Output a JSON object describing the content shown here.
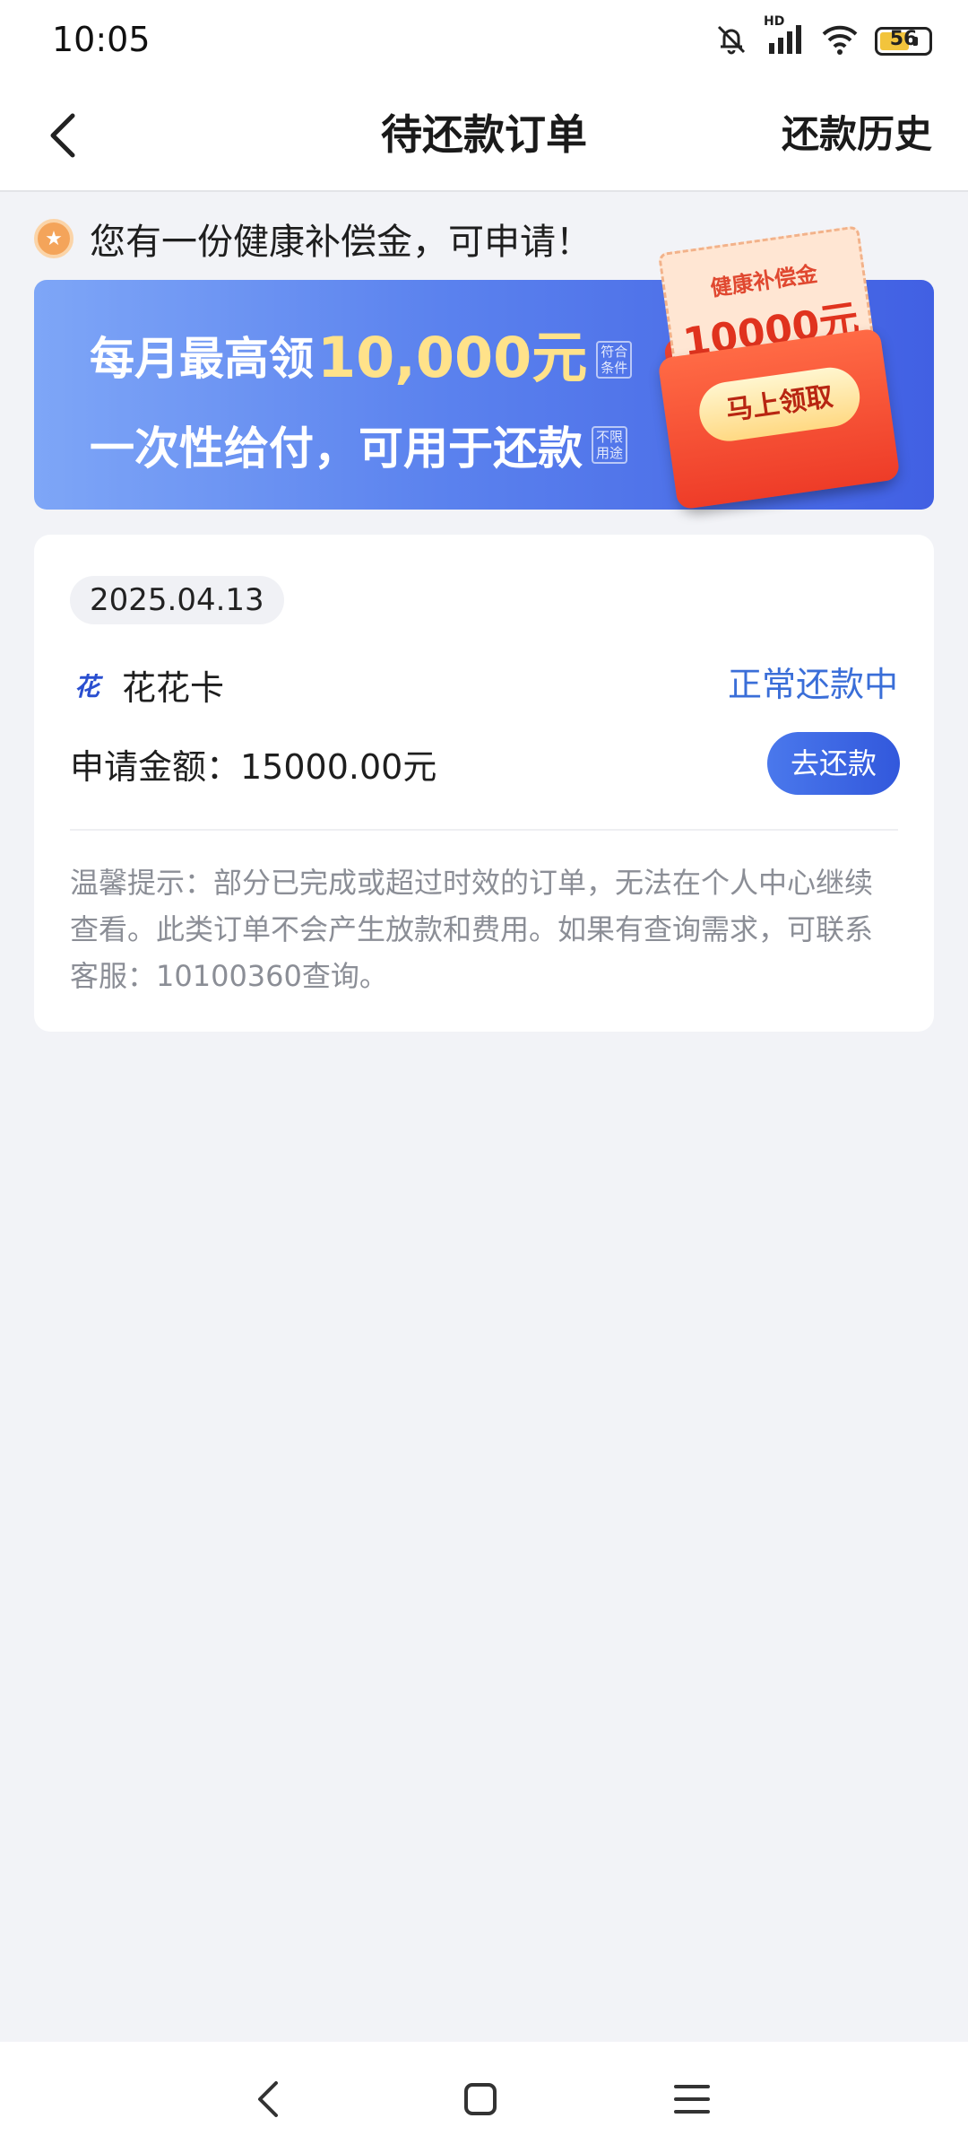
{
  "status_bar": {
    "time": "10:05",
    "network": "HD",
    "battery": "56",
    "icons": [
      "mute-icon",
      "signal-icon",
      "wifi-icon",
      "battery-icon"
    ]
  },
  "navbar": {
    "title": "待还款订单",
    "right_link": "还款历史",
    "back_icon": "chevron-left-icon"
  },
  "notice": {
    "text": "您有一份健康补偿金，可申请！",
    "icon": "star-coin-icon"
  },
  "banner": {
    "line1_prefix": "每月最高领",
    "line1_amount": "10,000元",
    "line1_tag": "符合条件",
    "line2": "一次性给付，可用于还款",
    "line2_tag": "不限用途",
    "card_title": "健康补偿金",
    "card_amount": "10000元",
    "cta": "马上领取",
    "colors": {
      "bg_start": "#7ea6f7",
      "bg_end": "#4160e3",
      "highlight": "#ffe28a",
      "envelope": "#ee3c28"
    }
  },
  "order": {
    "date": "2025.04.13",
    "product_logo": "花",
    "product_name": "花花卡",
    "status": "正常还款中",
    "amount_label": "申请金额：15000.00元",
    "repay_button": "去还款",
    "tip": "温馨提示：部分已完成或超过时效的订单，无法在个人中心继续查看。此类订单不会产生放款和费用。如果有查询需求，可联系客服：10100360查询。",
    "colors": {
      "status": "#3a6ed8",
      "button": "#3258dc"
    }
  },
  "system_nav": {
    "icons": [
      "back-icon",
      "home-icon",
      "menu-icon"
    ]
  }
}
